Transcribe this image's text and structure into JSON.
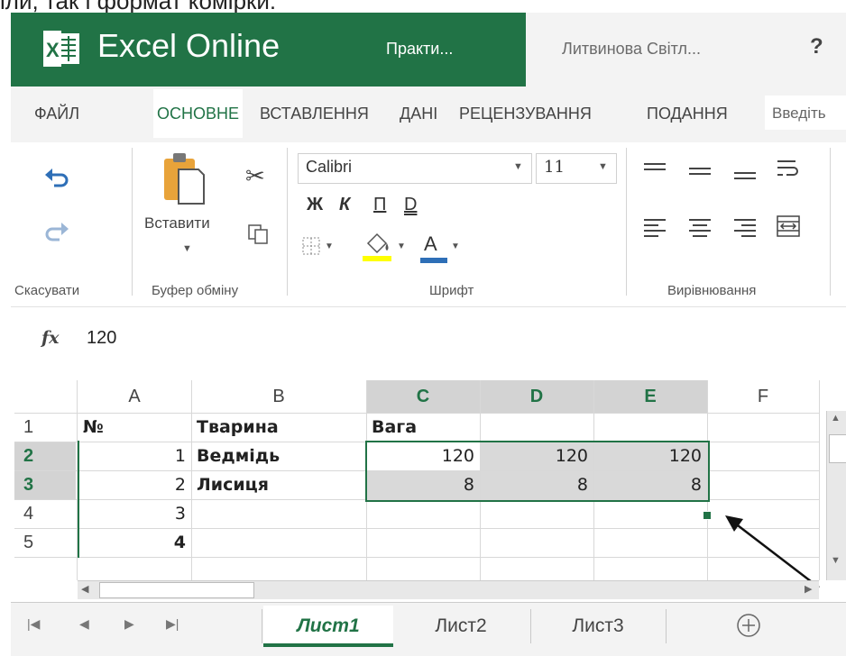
{
  "caption": "іли, так і формат комірки:",
  "app": {
    "name": "Excel Online",
    "logo_letter": "X",
    "doc_title": "Практи...",
    "user": "Литвинова Світл...",
    "help": "?"
  },
  "ribbon_tabs": [
    "ФАЙЛ",
    "ОСНОВНЕ",
    "ВСТАВЛЕННЯ",
    "ДАНІ",
    "РЕЦЕНЗУВАННЯ",
    "ПОДАННЯ"
  ],
  "tell_me": "Введіть",
  "undo_group": {
    "label": "Скасувати"
  },
  "clipboard": {
    "paste_label": "Вставити",
    "label": "Буфер обміну"
  },
  "font": {
    "name": "Calibri",
    "size": "11",
    "bold": "Ж",
    "italic": "К",
    "underline": "П",
    "double_underline": "D",
    "font_color_letter": "A",
    "label": "Шрифт"
  },
  "alignment": {
    "label": "Вирівнювання"
  },
  "formula_bar": {
    "fx": "fx",
    "value": "120"
  },
  "columns": [
    "A",
    "B",
    "C",
    "D",
    "E",
    "F"
  ],
  "rows": [
    {
      "num": "1",
      "A": "№",
      "B": "Тварина",
      "C": "Вага",
      "D": "",
      "E": ""
    },
    {
      "num": "2",
      "A": "1",
      "B": "Ведмідь",
      "C": "120",
      "D": "120",
      "E": "120"
    },
    {
      "num": "3",
      "A": "2",
      "B": "Лисиця",
      "C": "8",
      "D": "8",
      "E": "8"
    },
    {
      "num": "4",
      "A": "3",
      "B": "",
      "C": "",
      "D": "",
      "E": ""
    },
    {
      "num": "5",
      "A": "4",
      "B": "",
      "C": "",
      "D": "",
      "E": ""
    }
  ],
  "sheets": [
    "Лист1",
    "Лист2",
    "Лист3"
  ],
  "colors": {
    "brand": "#217346",
    "selection_gray": "#d9d9d9"
  }
}
